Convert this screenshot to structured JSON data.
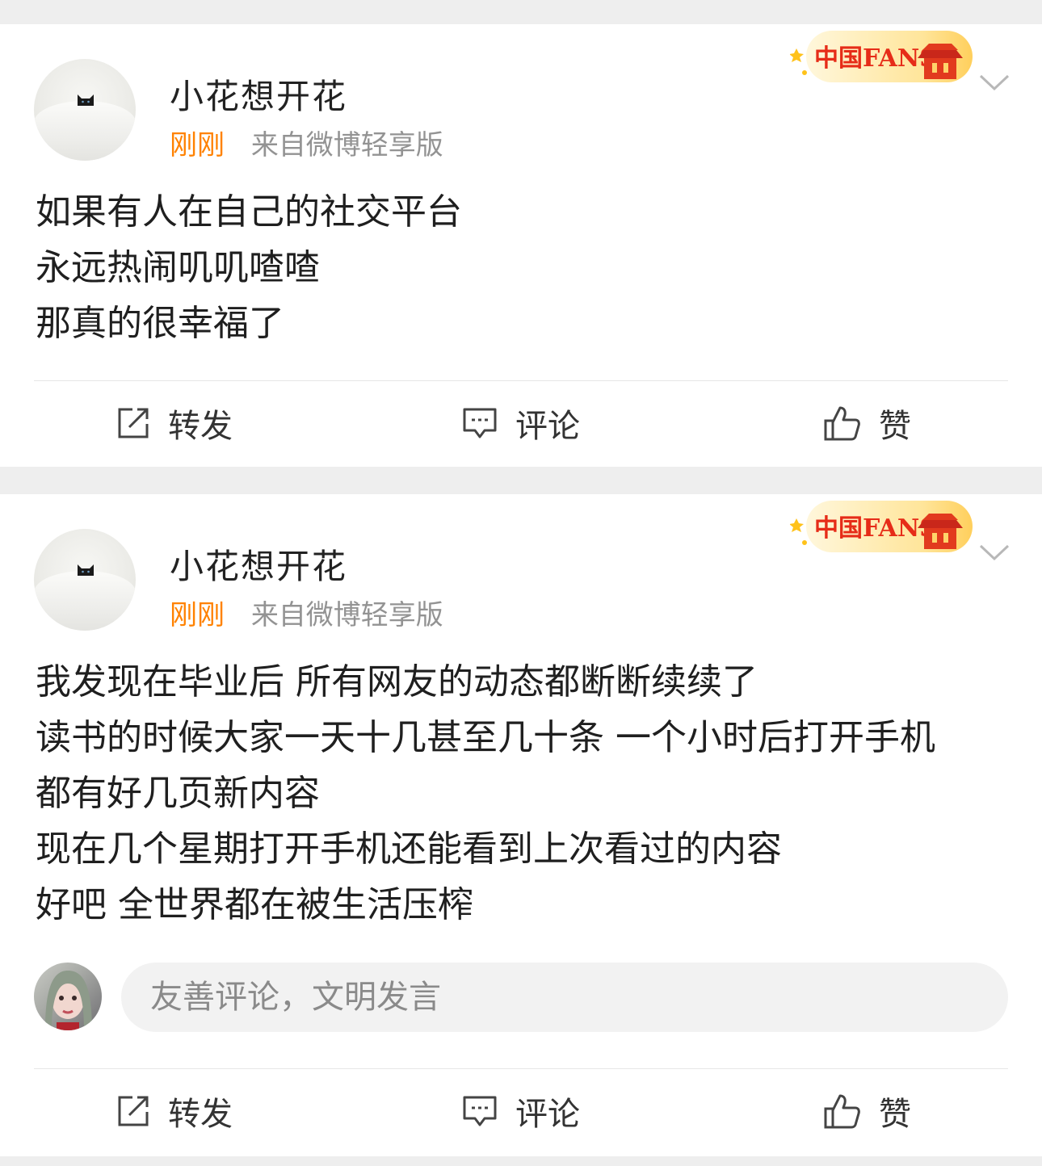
{
  "posts": [
    {
      "username": "小花想开花",
      "time": "刚刚",
      "source": "来自微博轻享版",
      "badge": "中国FANS",
      "content_lines": [
        "如果有人在自己的社交平台",
        "永远热闹叽叽喳喳",
        "那真的很幸福了"
      ],
      "actions": {
        "repost": "转发",
        "comment": "评论",
        "like": "赞"
      }
    },
    {
      "username": "小花想开花",
      "time": "刚刚",
      "source": "来自微博轻享版",
      "badge": "中国FANS",
      "content_lines": [
        "我发现在毕业后 所有网友的动态都断断续续了",
        "读书的时候大家一天十几甚至几十条 一个小时后打开手机",
        "都有好几页新内容",
        "现在几个星期打开手机还能看到上次看过的内容",
        "好吧 全世界都在被生活压榨"
      ],
      "comment_placeholder": "友善评论，文明发言",
      "actions": {
        "repost": "转发",
        "comment": "评论",
        "like": "赞"
      }
    }
  ],
  "icons": {
    "repost": "repost-icon",
    "comment": "comment-icon",
    "like": "thumbs-up-icon",
    "more": "chevron-down-icon"
  },
  "colors": {
    "time": "#ff8200",
    "source": "#939393",
    "text": "#1f1f1f",
    "background": "#eeeeee"
  }
}
